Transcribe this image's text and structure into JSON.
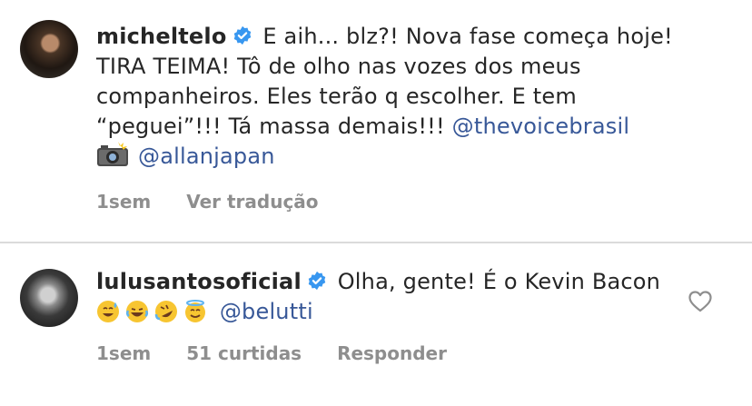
{
  "comments": [
    {
      "username": "micheltelo",
      "text": "E aih... blz?! Nova fase começa hoje! TIRA TEIMA! Tô de olho nas vozes dos meus companheiros. Eles terão q escolher. E tem “peguei”!!! Tá massa demais!!!",
      "mention1": "@thevoicebrasil",
      "mention2": "@allanjapan",
      "time": "1sem",
      "action": "Ver tradução"
    },
    {
      "username": "lulusantosoficial",
      "text": "Olha, gente! É o Kevin Bacon",
      "mention": "@belutti",
      "time": "1sem",
      "likes": "51 curtidas",
      "action": "Responder"
    }
  ],
  "icons": [
    "verified-badge-icon",
    "camera-flash-icon",
    "sweat-smile-emoji",
    "joy-emoji",
    "rofl-emoji",
    "innocent-emoji",
    "heart-outline-icon"
  ],
  "colors": {
    "mention": "#385898",
    "meta": "#8e8e8e",
    "verified": "#3897f0",
    "divider": "#dbdbdb"
  }
}
